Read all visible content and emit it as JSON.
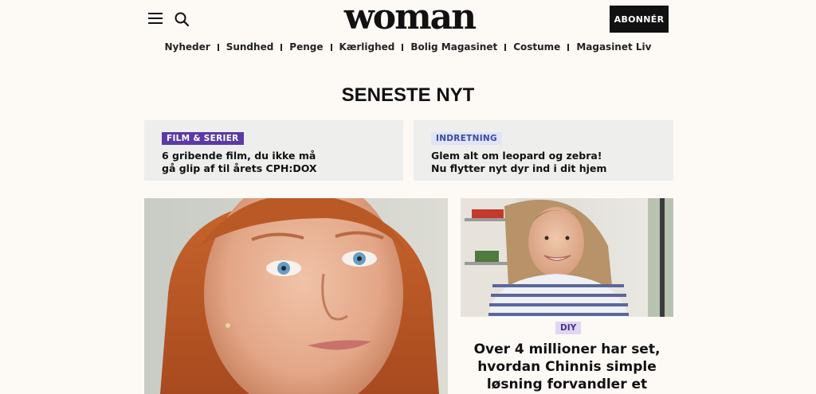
{
  "header": {
    "logo": "woman",
    "subscribe_label": "ABONNÉR",
    "menu_icon": "hamburger-menu-icon",
    "search_icon": "search-icon"
  },
  "nav": {
    "items": [
      "Nyheder",
      "Sundhed",
      "Penge",
      "Kærlighed",
      "Bolig Magasinet",
      "Costume",
      "Magasinet Liv"
    ]
  },
  "section": {
    "title": "SENESTE NYT"
  },
  "cards": [
    {
      "tag": "FILM & SERIER",
      "title_line1": "6 gribende film, du ikke må",
      "title_line2": "gå glip af til årets CPH:DOX"
    },
    {
      "tag": "INDRETNING",
      "title_line1": "Glem alt om leopard og zebra!",
      "title_line2": "Nu flytter nyt dyr ind i dit hjem"
    }
  ],
  "feature": {
    "tag": "DIY",
    "headline_line1": "Over 4 millioner har set,",
    "headline_line2": "hvordan Chinnis simple",
    "headline_line3": "løsning forvandler et"
  },
  "colors": {
    "background": "#fdfaf6",
    "subscribe_bg": "#111111",
    "tag_purple": "#5b3aa6",
    "tag_light": "#dfe4f7",
    "card_bg": "#eeeeec"
  }
}
